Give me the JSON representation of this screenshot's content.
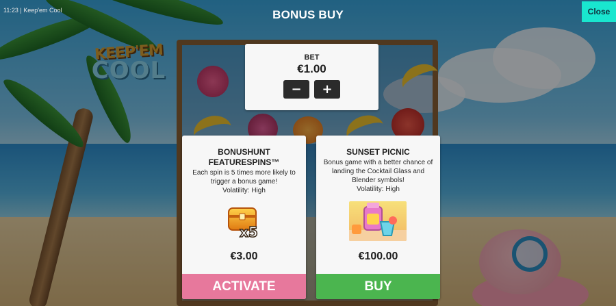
{
  "status": {
    "time": "11:23",
    "game_name": "Keep'em Cool"
  },
  "header": {
    "title": "BONUS BUY",
    "close_label": "Close"
  },
  "logo": {
    "line1": "KEEP'EM",
    "line2": "COOL"
  },
  "bet": {
    "label": "BET",
    "value": "€1.00",
    "decrease_label": "−",
    "increase_label": "+"
  },
  "cards": [
    {
      "title_line1": "BONUSHUNT",
      "title_line2": "FEATURESPINS™",
      "description": "Each spin is 5 times more likely to trigger a bonus game!",
      "volatility": "Volatility: High",
      "icon": "treasure-chest-x5",
      "icon_badge": "x5",
      "price": "€3.00",
      "action_label": "ACTIVATE",
      "action_color": "#e7789c"
    },
    {
      "title_line1": "SUNSET PICNIC",
      "title_line2": "",
      "description": "Bonus game with a better chance of landing the Cocktail Glass and Blender symbols!",
      "volatility": "Volatility: High",
      "icon": "picnic-blender-cocktail",
      "price": "€100.00",
      "action_label": "BUY",
      "action_color": "#4bb54f"
    }
  ],
  "colors": {
    "close_button": "#19e6cf",
    "panel_bg": "#f7f7f7",
    "bet_button": "#2b2b2b"
  }
}
